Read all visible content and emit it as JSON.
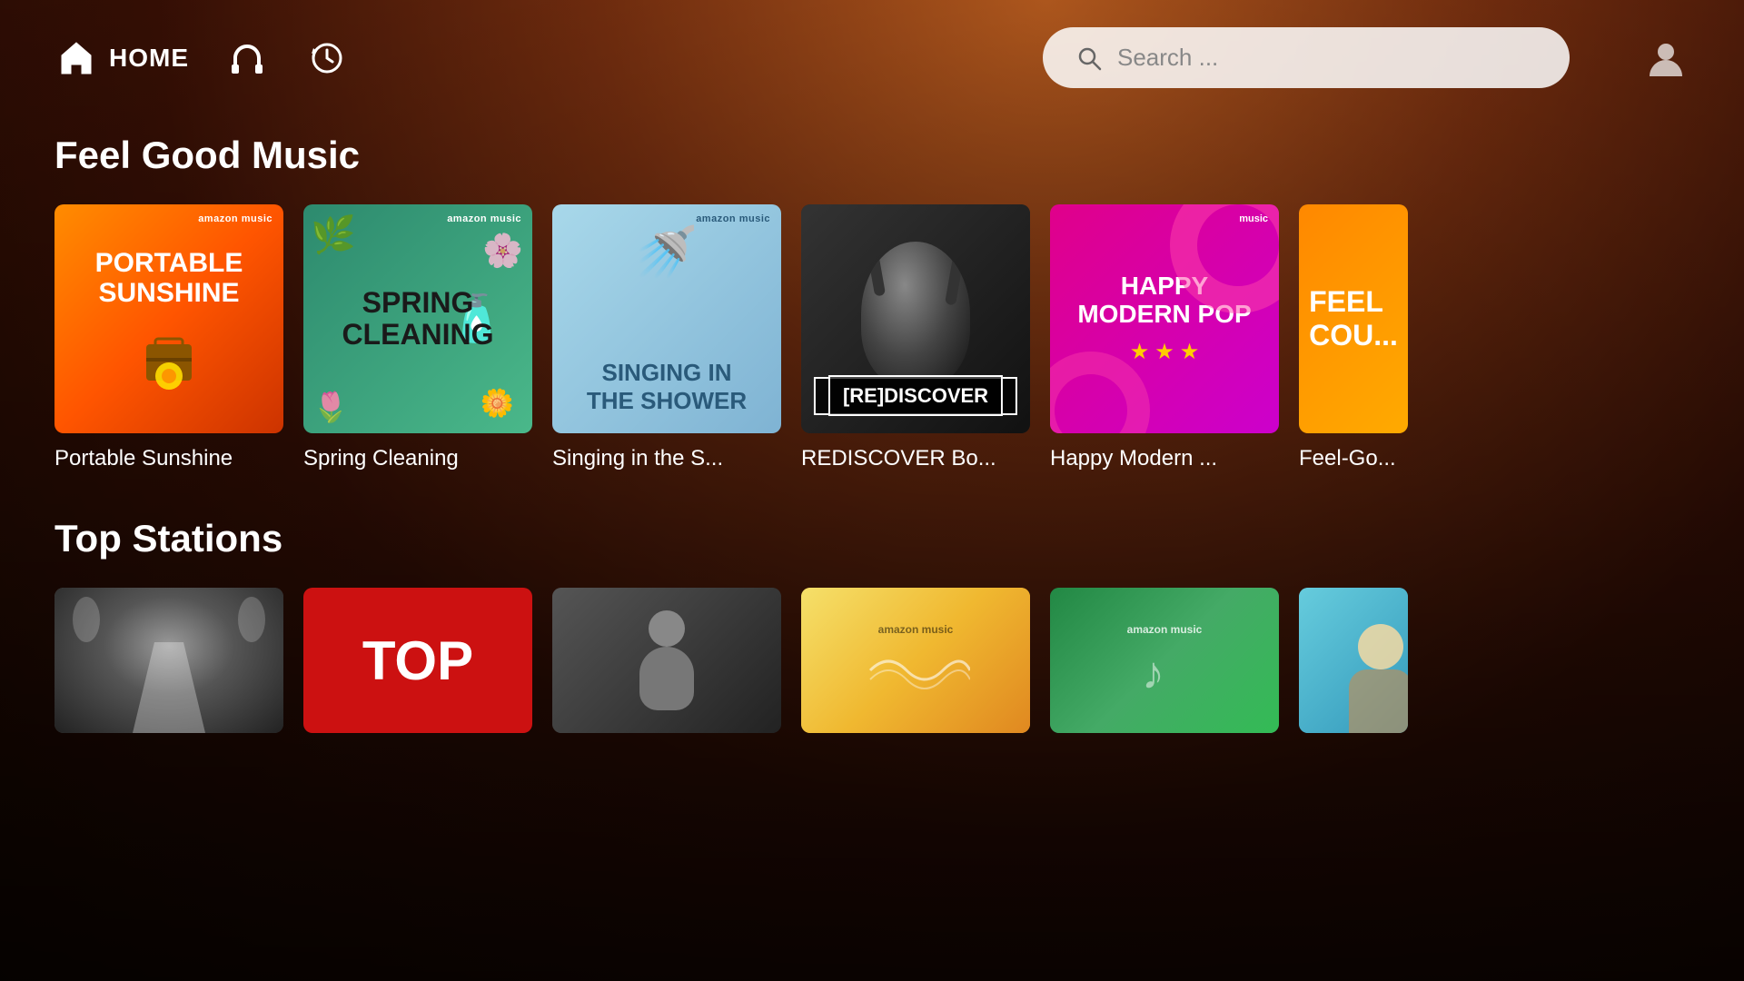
{
  "background": {
    "gradient_colors": [
      "#c06020",
      "#7a3010",
      "#3a1005",
      "#1a0800"
    ]
  },
  "header": {
    "home_label": "HOME",
    "search_placeholder": "Search ...",
    "nav_items": [
      {
        "id": "home",
        "label": "HOME",
        "icon": "home-icon"
      },
      {
        "id": "headphones",
        "label": "",
        "icon": "headphones-icon"
      },
      {
        "id": "history",
        "label": "",
        "icon": "history-icon"
      }
    ]
  },
  "sections": [
    {
      "id": "feel-good-music",
      "title": "Feel Good Music",
      "cards": [
        {
          "id": "portable-sunshine",
          "title": "Portable Sunshine",
          "label": "Portable Sunshine",
          "badge": "amazon music",
          "type": "portable-sunshine"
        },
        {
          "id": "spring-cleaning",
          "title": "Spring Cleaning",
          "label": "Spring Cleaning",
          "badge": "amazon music",
          "type": "spring-cleaning"
        },
        {
          "id": "singing-shower",
          "title": "Singing in the S...",
          "label": "Singing in the S...",
          "badge": "amazon music",
          "type": "singing-shower"
        },
        {
          "id": "rediscover",
          "title": "REDISCOVER Bo...",
          "label": "REDISCOVER Bo...",
          "badge": "amazon music",
          "type": "rediscover"
        },
        {
          "id": "happy-modern-pop",
          "title": "Happy Modern ...",
          "label": "Happy Modern ...",
          "badge": "music",
          "type": "happy-modern-pop"
        },
        {
          "id": "feel-good-cou",
          "title": "Feel-Go...",
          "label": "Feel-Go...",
          "type": "feel-good"
        }
      ]
    },
    {
      "id": "top-stations",
      "title": "Top Stations",
      "cards": [
        {
          "id": "artist-station-1",
          "label": "",
          "type": "artist-1"
        },
        {
          "id": "top-station",
          "label": "ToP",
          "type": "top-red"
        },
        {
          "id": "artist-station-3",
          "label": "",
          "type": "artist-3"
        },
        {
          "id": "amazon-grad-station",
          "label": "",
          "badge": "amazon music",
          "type": "amazon-grad"
        },
        {
          "id": "amazon-music-station",
          "label": "",
          "badge": "amazon music",
          "type": "amazon-music"
        },
        {
          "id": "teal-station",
          "label": "",
          "type": "teal"
        }
      ]
    }
  ],
  "portable_sunshine_line1": "PORTABLE",
  "portable_sunshine_line2": "SUNSHINE",
  "spring_cleaning_line1": "SPRING",
  "spring_cleaning_line2": "CLEANING",
  "singing_line1": "SINGING IN",
  "singing_line2": "THE SHOWER",
  "rediscover_text": "[RE]DISCOVER",
  "happy_pop_line1": "HAPPY",
  "happy_pop_line2": "MODERN POP",
  "top_text": "TOP",
  "amazon_music_text": "amazon music",
  "music_text": "music"
}
